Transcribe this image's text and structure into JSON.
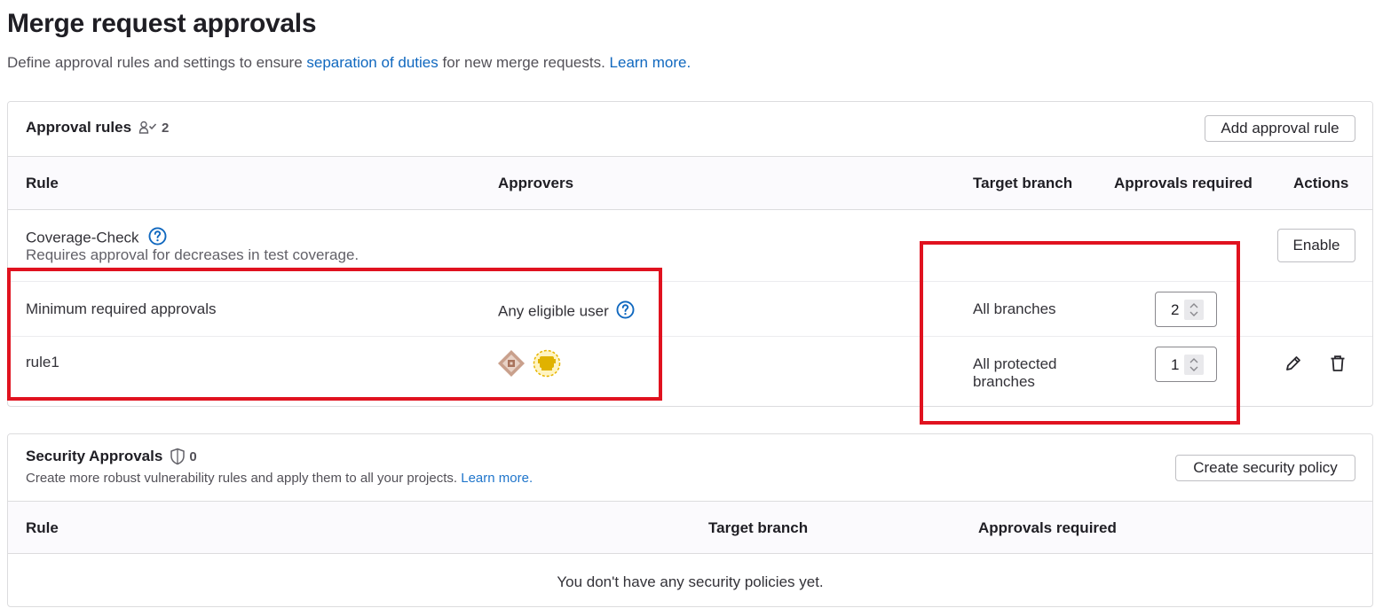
{
  "page": {
    "title": "Merge request approvals",
    "desc_prefix": "Define approval rules and settings to ensure ",
    "desc_link": "separation of duties",
    "desc_middle": " for new merge requests. ",
    "desc_learn_more": "Learn more."
  },
  "approval_rules": {
    "title": "Approval rules",
    "count": "2",
    "add_button": "Add approval rule",
    "columns": {
      "rule": "Rule",
      "approvers": "Approvers",
      "target_branch": "Target branch",
      "approvals_required": "Approvals required",
      "actions": "Actions"
    },
    "coverage": {
      "name": "Coverage-Check",
      "description": "Requires approval for decreases in test coverage.",
      "enable_button": "Enable"
    },
    "rows": [
      {
        "rule": "Minimum required approvals",
        "approvers": "Any eligible user",
        "target_branch": "All branches",
        "approvals": "2"
      },
      {
        "rule": "rule1",
        "approvers_avatars": [
          "identicon-avatar-brown",
          "identicon-avatar-yellow"
        ],
        "target_branch_line1": "All protected",
        "target_branch_line2": "branches",
        "approvals": "1"
      }
    ]
  },
  "security_approvals": {
    "title": "Security Approvals",
    "count": "0",
    "description_prefix": "Create more robust vulnerability rules and apply them to all your projects. ",
    "learn_more": "Learn more.",
    "create_button": "Create security policy",
    "columns": {
      "rule": "Rule",
      "target_branch": "Target branch",
      "approvals_required": "Approvals required"
    },
    "empty_message": "You don't have any security policies yet."
  },
  "colors": {
    "link": "#1068bf",
    "annotation": "#e0121f",
    "header_bg": "#fbfafd",
    "border": "#dcdcde"
  }
}
